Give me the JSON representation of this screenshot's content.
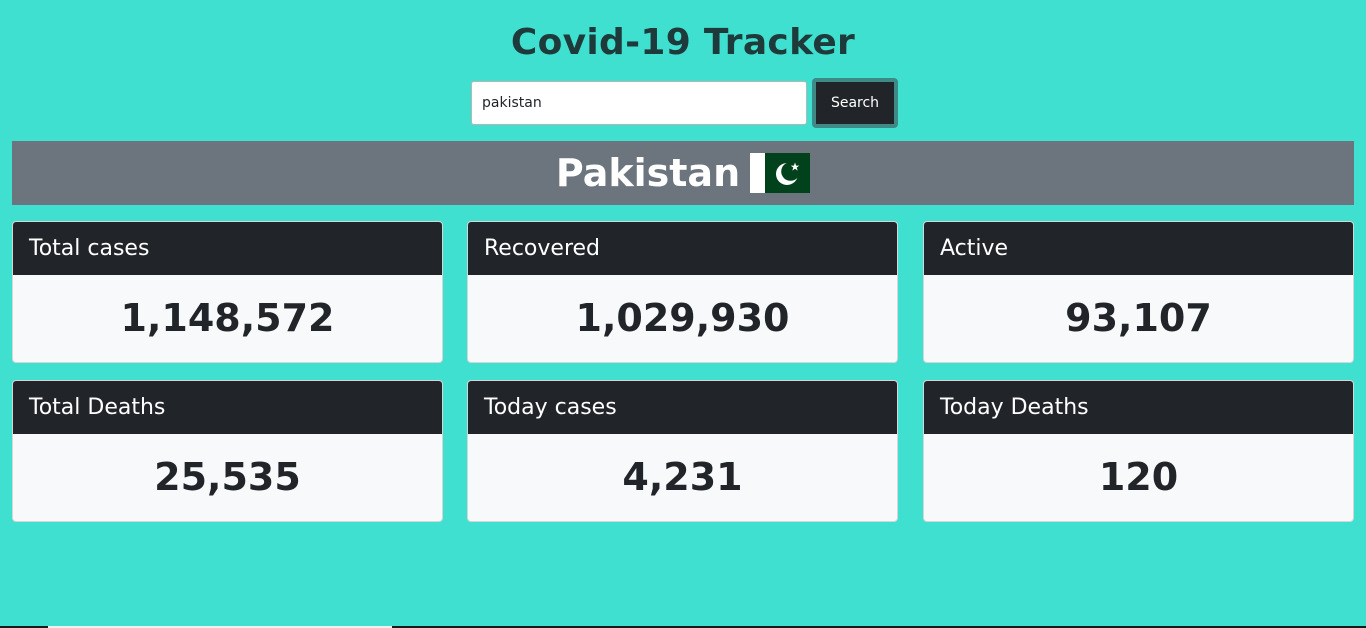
{
  "app": {
    "title": "Covid-19 Tracker"
  },
  "search": {
    "value": "pakistan",
    "placeholder": "",
    "button_label": "Search"
  },
  "country": {
    "name": "Pakistan",
    "flag_icon": "pakistan-flag-icon",
    "flag_colors": {
      "green": "#01411c",
      "white": "#ffffff"
    }
  },
  "stats": [
    {
      "label": "Total cases",
      "value": "1,148,572"
    },
    {
      "label": "Recovered",
      "value": "1,029,930"
    },
    {
      "label": "Active",
      "value": "93,107"
    },
    {
      "label": "Total Deaths",
      "value": "25,535"
    },
    {
      "label": "Today cases",
      "value": "4,231"
    },
    {
      "label": "Today Deaths",
      "value": "120"
    }
  ],
  "colors": {
    "background": "#40e0d0",
    "banner": "#6c757d",
    "card_header": "#212529",
    "card_body": "#f8f9fa"
  }
}
